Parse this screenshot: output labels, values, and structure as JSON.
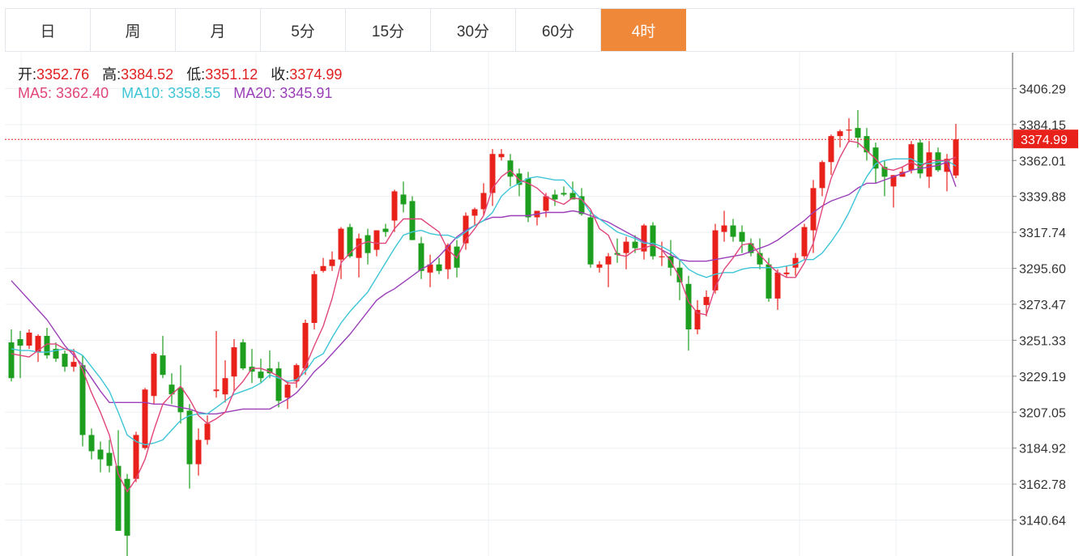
{
  "tabs": [
    "日",
    "周",
    "月",
    "5分",
    "15分",
    "30分",
    "60分",
    "4时"
  ],
  "active_tab": 7,
  "ohlc_summary": {
    "open_label": "开:",
    "open": "3352.76",
    "high_label": "高:",
    "high": "3384.52",
    "low_label": "低:",
    "low": "3351.12",
    "close_label": "收:",
    "close": "3374.99"
  },
  "ma_summary": {
    "ma5_label": "MA5:",
    "ma5": "3362.40",
    "ma10_label": "MA10:",
    "ma10": "3358.55",
    "ma20_label": "MA20:",
    "ma20": "3345.91"
  },
  "colors": {
    "up": "#e8221b",
    "down": "#1e9e1e",
    "ma5": "#e0457b",
    "ma10": "#3ec5d6",
    "ma20": "#9a3fb8",
    "accent": "#f0883a"
  },
  "chart_data": {
    "type": "candlestick",
    "y_ticks": [
      "3406.29",
      "3384.15",
      "3362.01",
      "3339.88",
      "3317.74",
      "3295.60",
      "3273.47",
      "3251.33",
      "3229.19",
      "3207.05",
      "3184.92",
      "3162.78",
      "3140.64"
    ],
    "ylim": [
      3118.5,
      3428.4
    ],
    "last_price": "3374.99",
    "grid": true,
    "candles": [
      [
        3250,
        3258,
        3226,
        3228
      ],
      [
        3252,
        3257,
        3228,
        3248
      ],
      [
        3248,
        3258,
        3246,
        3256
      ],
      [
        3244,
        3255,
        3238,
        3254
      ],
      [
        3254,
        3259,
        3240,
        3242
      ],
      [
        3246,
        3250,
        3238,
        3240
      ],
      [
        3243,
        3245,
        3232,
        3235
      ],
      [
        3235,
        3246,
        3232,
        3238
      ],
      [
        3236,
        3242,
        3186,
        3193
      ],
      [
        3193,
        3197,
        3178,
        3183
      ],
      [
        3184,
        3189,
        3170,
        3178
      ],
      [
        3182,
        3190,
        3170,
        3174
      ],
      [
        3174,
        3196,
        3134,
        3134
      ],
      [
        3166,
        3169,
        3118,
        3131
      ],
      [
        3166,
        3195,
        3164,
        3193
      ],
      [
        3185,
        3222,
        3184,
        3221
      ],
      [
        3217,
        3244,
        3212,
        3243
      ],
      [
        3242,
        3254,
        3228,
        3230
      ],
      [
        3224,
        3231,
        3212,
        3218
      ],
      [
        3222,
        3236,
        3200,
        3207
      ],
      [
        3208,
        3212,
        3160,
        3175
      ],
      [
        3175,
        3197,
        3168,
        3190
      ],
      [
        3190,
        3205,
        3187,
        3200
      ],
      [
        3220,
        3257,
        3216,
        3221
      ],
      [
        3218,
        3239,
        3213,
        3228
      ],
      [
        3229,
        3252,
        3220,
        3247
      ],
      [
        3250,
        3252,
        3233,
        3234
      ],
      [
        3235,
        3246,
        3225,
        3232
      ],
      [
        3232,
        3240,
        3225,
        3228
      ],
      [
        3234,
        3245,
        3228,
        3231
      ],
      [
        3234,
        3238,
        3210,
        3214
      ],
      [
        3216,
        3226,
        3209,
        3224
      ],
      [
        3226,
        3237,
        3222,
        3236
      ],
      [
        3234,
        3264,
        3230,
        3262
      ],
      [
        3262,
        3294,
        3258,
        3292
      ],
      [
        3294,
        3302,
        3293,
        3297
      ],
      [
        3297,
        3306,
        3294,
        3301
      ],
      [
        3301,
        3321,
        3289,
        3320
      ],
      [
        3321,
        3323,
        3302,
        3303
      ],
      [
        3302,
        3317,
        3290,
        3314
      ],
      [
        3316,
        3320,
        3298,
        3305
      ],
      [
        3307,
        3319,
        3303,
        3319
      ],
      [
        3320,
        3323,
        3315,
        3318
      ],
      [
        3325,
        3344,
        3318,
        3343
      ],
      [
        3341,
        3349,
        3330,
        3335
      ],
      [
        3337,
        3340,
        3313,
        3313
      ],
      [
        3311,
        3315,
        3289,
        3294
      ],
      [
        3293,
        3304,
        3284,
        3298
      ],
      [
        3298,
        3302,
        3292,
        3294
      ],
      [
        3295,
        3311,
        3289,
        3310
      ],
      [
        3309,
        3313,
        3290,
        3296
      ],
      [
        3311,
        3330,
        3307,
        3328
      ],
      [
        3328,
        3333,
        3322,
        3332
      ],
      [
        3332,
        3348,
        3328,
        3342
      ],
      [
        3342,
        3369,
        3334,
        3366
      ],
      [
        3364,
        3369,
        3362,
        3366
      ],
      [
        3362,
        3366,
        3346,
        3352
      ],
      [
        3354,
        3357,
        3340,
        3347
      ],
      [
        3351,
        3355,
        3324,
        3327
      ],
      [
        3327,
        3331,
        3322,
        3331
      ],
      [
        3331,
        3342,
        3327,
        3340
      ],
      [
        3341,
        3344,
        3334,
        3338
      ],
      [
        3342,
        3346,
        3340,
        3341
      ],
      [
        3342,
        3349,
        3338,
        3338
      ],
      [
        3340,
        3345,
        3328,
        3329
      ],
      [
        3327,
        3331,
        3296,
        3298
      ],
      [
        3296,
        3300,
        3293,
        3298
      ],
      [
        3298,
        3305,
        3284,
        3303
      ],
      [
        3305,
        3314,
        3299,
        3304
      ],
      [
        3305,
        3315,
        3295,
        3312
      ],
      [
        3312,
        3316,
        3305,
        3308
      ],
      [
        3306,
        3323,
        3301,
        3322
      ],
      [
        3322,
        3324,
        3301,
        3303
      ],
      [
        3303,
        3312,
        3297,
        3303
      ],
      [
        3303,
        3313,
        3291,
        3296
      ],
      [
        3296,
        3301,
        3276,
        3287
      ],
      [
        3286,
        3291,
        3245,
        3258
      ],
      [
        3258,
        3276,
        3255,
        3270
      ],
      [
        3273,
        3282,
        3266,
        3278
      ],
      [
        3282,
        3323,
        3280,
        3319
      ],
      [
        3318,
        3331,
        3312,
        3322
      ],
      [
        3322,
        3326,
        3312,
        3315
      ],
      [
        3318,
        3322,
        3305,
        3312
      ],
      [
        3311,
        3314,
        3303,
        3305
      ],
      [
        3305,
        3314,
        3295,
        3298
      ],
      [
        3298,
        3302,
        3275,
        3277
      ],
      [
        3277,
        3295,
        3270,
        3293
      ],
      [
        3292,
        3297,
        3290,
        3293
      ],
      [
        3296,
        3305,
        3291,
        3302
      ],
      [
        3303,
        3323,
        3301,
        3321
      ],
      [
        3319,
        3350,
        3305,
        3345
      ],
      [
        3345,
        3362,
        3340,
        3361
      ],
      [
        3361,
        3378,
        3353,
        3377
      ],
      [
        3377,
        3381,
        3370,
        3380
      ],
      [
        3381,
        3388,
        3373,
        3381
      ],
      [
        3382,
        3393,
        3370,
        3376
      ],
      [
        3377,
        3382,
        3362,
        3367
      ],
      [
        3370,
        3373,
        3348,
        3357
      ],
      [
        3358,
        3362,
        3340,
        3352
      ],
      [
        3346,
        3353,
        3333,
        3353
      ],
      [
        3352,
        3358,
        3352,
        3355
      ],
      [
        3356,
        3374,
        3354,
        3372
      ],
      [
        3373,
        3375,
        3351,
        3354
      ],
      [
        3352,
        3374,
        3345,
        3367
      ],
      [
        3367,
        3370,
        3355,
        3356
      ],
      [
        3355,
        3366,
        3343,
        3363
      ],
      [
        3352.76,
        3384.52,
        3351.12,
        3374.99
      ]
    ],
    "ma5": [
      3243,
      3242,
      3241,
      3245,
      3249,
      3249,
      3246,
      3244,
      3233,
      3219,
      3207,
      3193,
      3169,
      3158,
      3166,
      3178,
      3196,
      3212,
      3218,
      3223,
      3215,
      3205,
      3200,
      3203,
      3207,
      3220,
      3226,
      3234,
      3234,
      3232,
      3229,
      3225,
      3225,
      3235,
      3248,
      3260,
      3277,
      3299,
      3305,
      3310,
      3312,
      3311,
      3311,
      3320,
      3326,
      3326,
      3326,
      3322,
      3318,
      3307,
      3302,
      3313,
      3320,
      3328,
      3345,
      3352,
      3356,
      3350,
      3348,
      3345,
      3340,
      3337,
      3335,
      3339,
      3338,
      3332,
      3320,
      3316,
      3304,
      3303,
      3307,
      3308,
      3310,
      3307,
      3300,
      3290,
      3275,
      3268,
      3267,
      3284,
      3295,
      3302,
      3310,
      3311,
      3304,
      3298,
      3293,
      3290,
      3290,
      3299,
      3311,
      3332,
      3351,
      3364,
      3374,
      3373,
      3368,
      3363,
      3357,
      3356,
      3358,
      3361,
      3358,
      3362,
      3362,
      3362,
      3364
    ],
    "ma10": [
      3246,
      3245,
      3245,
      3244,
      3244,
      3245,
      3246,
      3245,
      3242,
      3235,
      3228,
      3220,
      3207,
      3193,
      3189,
      3187,
      3188,
      3190,
      3196,
      3202,
      3205,
      3206,
      3206,
      3210,
      3214,
      3218,
      3220,
      3222,
      3225,
      3230,
      3228,
      3226,
      3227,
      3232,
      3240,
      3243,
      3253,
      3262,
      3269,
      3275,
      3281,
      3290,
      3299,
      3308,
      3316,
      3318,
      3319,
      3317,
      3316,
      3316,
      3314,
      3318,
      3322,
      3325,
      3330,
      3340,
      3345,
      3348,
      3351,
      3352,
      3351,
      3350,
      3350,
      3344,
      3338,
      3330,
      3326,
      3322,
      3318,
      3316,
      3314,
      3311,
      3311,
      3309,
      3306,
      3301,
      3295,
      3292,
      3290,
      3292,
      3293,
      3293,
      3295,
      3296,
      3296,
      3296,
      3296,
      3297,
      3298,
      3301,
      3301,
      3305,
      3312,
      3320,
      3330,
      3342,
      3352,
      3360,
      3362,
      3363,
      3363,
      3363,
      3360,
      3360,
      3361,
      3362,
      3358.55
    ],
    "ma20": [
      3288,
      3282,
      3276,
      3270,
      3264,
      3256,
      3248,
      3242,
      3236,
      3228,
      3220,
      3213,
      3213,
      3213,
      3213,
      3213,
      3212,
      3212,
      3211,
      3210,
      3209,
      3207,
      3206,
      3206,
      3207,
      3208,
      3209,
      3209,
      3209,
      3209,
      3212,
      3215,
      3219,
      3225,
      3232,
      3237,
      3243,
      3249,
      3255,
      3262,
      3269,
      3276,
      3280,
      3283,
      3287,
      3291,
      3295,
      3298,
      3303,
      3309,
      3315,
      3319,
      3322,
      3325,
      3327,
      3327,
      3328,
      3328,
      3328,
      3329,
      3330,
      3330,
      3330,
      3331,
      3330,
      3328,
      3326,
      3324,
      3321,
      3318,
      3315,
      3312,
      3310,
      3307,
      3304,
      3301,
      3300,
      3300,
      3300,
      3301,
      3302,
      3303,
      3304,
      3306,
      3308,
      3310,
      3313,
      3317,
      3321,
      3325,
      3330,
      3334,
      3337,
      3339,
      3341,
      3345,
      3348,
      3348,
      3350,
      3352,
      3354,
      3356,
      3357,
      3358,
      3359,
      3361,
      3345.91
    ]
  }
}
